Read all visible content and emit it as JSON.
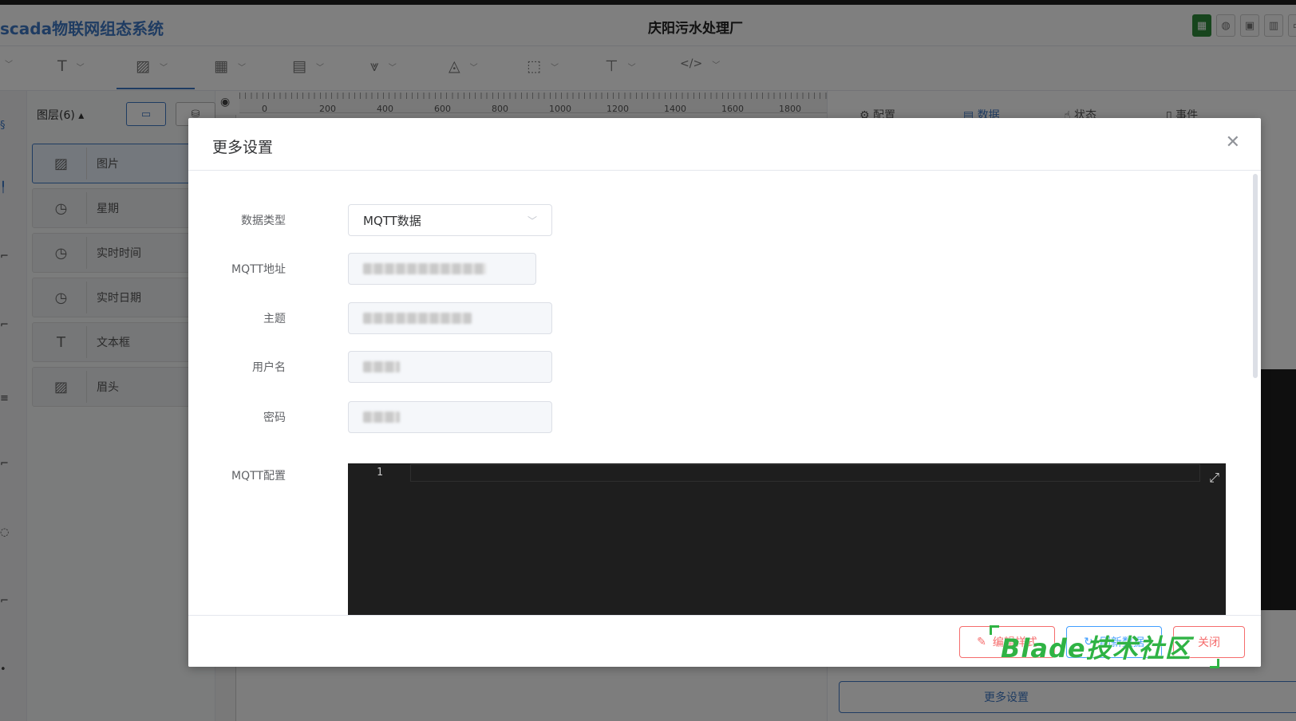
{
  "app": {
    "title": "scada物联网组态系统",
    "project_name": "庆阳污水处理厂",
    "top_actions": [
      "excel-icon",
      "palette-icon",
      "save-icon",
      "delete-icon",
      "screen-icon"
    ]
  },
  "toolbar": {
    "tools": [
      {
        "icon": "T",
        "name": "text-tool"
      },
      {
        "icon": "▨",
        "name": "image-tool"
      },
      {
        "icon": "▦",
        "name": "component-tool"
      },
      {
        "icon": "▤",
        "name": "table-tool"
      },
      {
        "icon": "⩔",
        "name": "filter-tool"
      },
      {
        "icon": "◬",
        "name": "shape-tool"
      },
      {
        "icon": "⬚",
        "name": "select-tool"
      },
      {
        "icon": "⊤",
        "name": "format-tool"
      },
      {
        "icon": "</>",
        "name": "code-tool"
      }
    ]
  },
  "layers": {
    "header": "图层(6)",
    "items": [
      {
        "icon": "▨",
        "label": "图片"
      },
      {
        "icon": "◷",
        "label": "星期"
      },
      {
        "icon": "◷",
        "label": "实时时间"
      },
      {
        "icon": "◷",
        "label": "实时日期"
      },
      {
        "icon": "T",
        "label": "文本框"
      },
      {
        "icon": "▨",
        "label": "眉头"
      }
    ]
  },
  "ruler": {
    "labels": [
      "0",
      "200",
      "400",
      "600",
      "800",
      "1000",
      "1200",
      "1400",
      "1600",
      "1800"
    ]
  },
  "right_panel": {
    "tabs": [
      {
        "icon": "⚙",
        "label": "配置"
      },
      {
        "icon": "▤",
        "label": "数据"
      },
      {
        "icon": "☝",
        "label": "状态"
      },
      {
        "icon": "▯",
        "label": "事件"
      }
    ],
    "more_settings": "更多设置"
  },
  "dialog": {
    "title": "更多设置",
    "fields": {
      "data_type": {
        "label": "数据类型",
        "value": "MQTT数据"
      },
      "mqtt_address": {
        "label": "MQTT地址"
      },
      "topic": {
        "label": "主题"
      },
      "username": {
        "label": "用户名"
      },
      "password": {
        "label": "密码"
      },
      "mqtt_config": {
        "label": "MQTT配置",
        "line_number": "1"
      }
    },
    "buttons": {
      "edit_style": "编辑样式",
      "refresh_data": "刷新数据",
      "close": "关闭"
    }
  },
  "watermark": "Blade技术社区",
  "colors": {
    "accent": "#3f78c5",
    "danger": "#f56c6c",
    "primary": "#409eff",
    "editor_bg": "#1e1e1e",
    "watermark": "#2fb344"
  }
}
